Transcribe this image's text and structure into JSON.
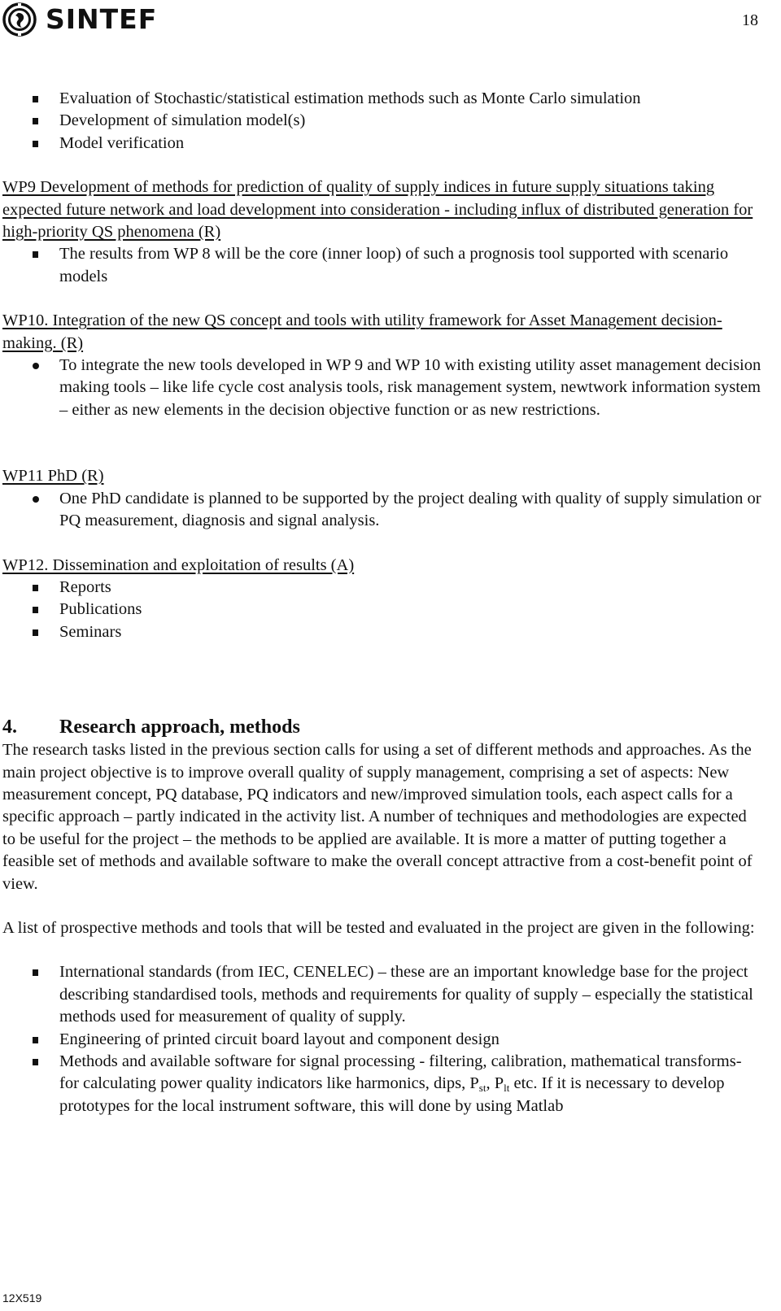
{
  "header": {
    "logo_text": "SINTEF",
    "page_number": "18"
  },
  "wp8_bullets": [
    "Evaluation of Stochastic/statistical estimation  methods such as Monte Carlo simulation",
    "Development of simulation model(s)",
    "Model verification"
  ],
  "wp9": {
    "heading": "WP9 Development of methods for prediction of quality of supply indices in future supply situations taking expected future network and load development into consideration - including influx of distributed generation for high-priority QS phenomena (R)",
    "bullets": [
      "The results from WP 8 will be the core (inner loop) of such a prognosis tool supported with scenario models"
    ]
  },
  "wp10": {
    "heading": "WP10. Integration of the new QS concept and tools with utility framework for Asset Management decision-making. (R)",
    "bullets": [
      "To integrate the new tools developed in WP 9 and WP 10  with existing utility asset management decision making tools –  like life cycle cost analysis tools, risk management system, newtwork information system – either as new elements in the decision objective function or as new restrictions."
    ]
  },
  "wp11": {
    "heading": "WP11 PhD (R)",
    "bullets": [
      "One PhD candidate is planned to be supported by the project dealing with quality of supply simulation or PQ measurement, diagnosis and signal analysis."
    ]
  },
  "wp12": {
    "heading": "WP12. Dissemination and exploitation of results (A)",
    "bullets": [
      "Reports",
      "Publications",
      "Seminars"
    ]
  },
  "section4": {
    "number": "4.",
    "title": "Research approach, methods",
    "paragraph1": "The research tasks listed in the previous section calls for using a set of different methods and approaches. As the main project objective is to improve overall quality of supply management, comprising a set of aspects: New measurement concept, PQ database, PQ indicators and new/improved simulation tools, each aspect calls for a specific approach – partly indicated in the activity list. A number of techniques and methodologies are expected to be useful for the project – the methods to be applied are available. It is more a matter of putting together a feasible set of methods and available software to make the overall concept attractive from a cost-benefit point of view.",
    "paragraph2": "A list of prospective methods and tools that will be tested and evaluated in the project are given in the following:",
    "bullets": {
      "b1": "International standards (from IEC, CENELEC) – these are an important knowledge base for the project describing standardised tools, methods and requirements for quality of supply – especially the statistical methods used for measurement of quality of supply.",
      "b2": "Engineering of printed circuit board layout and component design",
      "b3_part1": "Methods and available software for signal processing - filtering, calibration, mathematical transforms- for calculating power quality indicators like harmonics, dips, P",
      "b3_sub1": "st",
      "b3_part2": ", P",
      "b3_sub2": "lt",
      "b3_part3": " etc. If it is necessary to develop prototypes for the local instrument software, this will done by using Matlab"
    }
  },
  "footer": {
    "doc_code": "12X519"
  }
}
